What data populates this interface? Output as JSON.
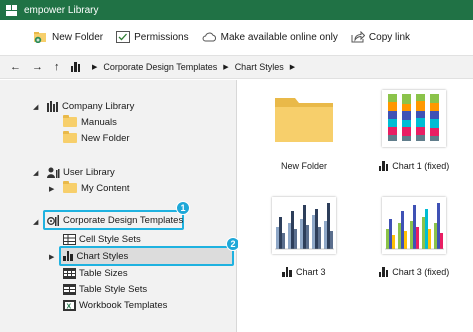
{
  "window": {
    "title": "empower Library"
  },
  "toolbar": {
    "new_folder": "New Folder",
    "permissions": "Permissions",
    "make_available": "Make available online only",
    "copy_link": "Copy link"
  },
  "breadcrumb": {
    "items": [
      "Corporate Design Templates",
      "Chart Styles"
    ]
  },
  "tree": {
    "company_library": "Company Library",
    "manuals": "Manuals",
    "new_folder": "New Folder",
    "user_library": "User Library",
    "my_content": "My Content",
    "corporate_design_templates": "Corporate Design Templates",
    "cell_style_sets": "Cell Style Sets",
    "chart_styles": "Chart Styles",
    "table_sizes": "Table Sizes",
    "table_style_sets": "Table Style Sets",
    "workbook_templates": "Workbook Templates"
  },
  "badges": {
    "one": "1",
    "two": "2"
  },
  "items": [
    {
      "label": "New Folder"
    },
    {
      "label": "Chart  1 (fixed)"
    },
    {
      "label": "Chart 3"
    },
    {
      "label": "Chart 3 (fixed)"
    }
  ],
  "colors": {
    "titlebar": "#207245",
    "highlight": "#1fb2e0",
    "badge": "#1fa8d8",
    "folder": "#f7cf6b"
  }
}
